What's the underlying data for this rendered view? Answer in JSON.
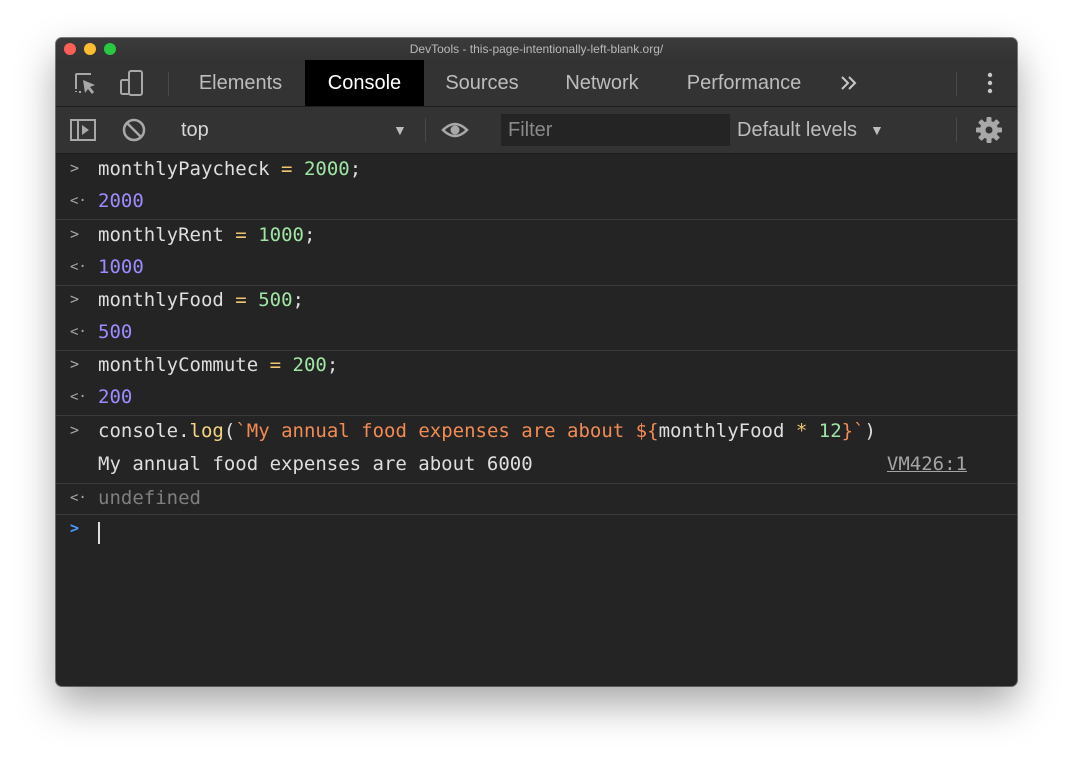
{
  "window": {
    "title": "DevTools - this-page-intentionally-left-blank.org/"
  },
  "tabs": [
    {
      "label": "Elements"
    },
    {
      "label": "Console"
    },
    {
      "label": "Sources"
    },
    {
      "label": "Network"
    },
    {
      "label": "Performance"
    }
  ],
  "active_tab": "Console",
  "toolbar": {
    "context": "top",
    "filter_placeholder": "Filter",
    "levels_label": "Default levels"
  },
  "console": {
    "entries": [
      {
        "input_var": "monthlyPaycheck",
        "input_value": "2000",
        "result": "2000"
      },
      {
        "input_var": "monthlyRent",
        "input_value": "1000",
        "result": "1000"
      },
      {
        "input_var": "monthlyFood",
        "input_value": "500",
        "result": "500"
      },
      {
        "input_var": "monthlyCommute",
        "input_value": "200",
        "result": "200"
      }
    ],
    "log_call": {
      "object": "console",
      "method": "log",
      "string_literal": "`My annual food expenses are about ${",
      "expr_var": "monthlyFood",
      "expr_num": "12",
      "string_end": "}`"
    },
    "log_output": "My annual food expenses are about 6000",
    "log_source": "VM426:1",
    "log_result": "undefined"
  },
  "colors": {
    "background": "#242424",
    "toolbar": "#333333",
    "number": "#a0e5a4",
    "result": "#9c8cff",
    "string": "#f28b54",
    "prompt_active": "#4a9cff"
  }
}
